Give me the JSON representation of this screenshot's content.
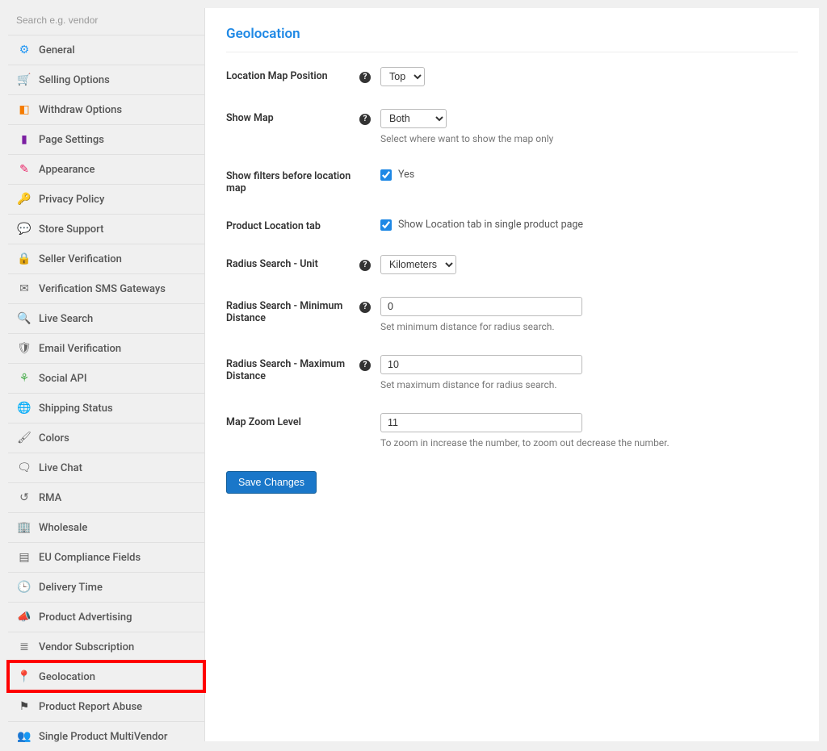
{
  "search": {
    "placeholder": "Search e.g. vendor"
  },
  "sidebar": {
    "items": [
      {
        "label": "General"
      },
      {
        "label": "Selling Options"
      },
      {
        "label": "Withdraw Options"
      },
      {
        "label": "Page Settings"
      },
      {
        "label": "Appearance"
      },
      {
        "label": "Privacy Policy"
      },
      {
        "label": "Store Support"
      },
      {
        "label": "Seller Verification"
      },
      {
        "label": "Verification SMS Gateways"
      },
      {
        "label": "Live Search"
      },
      {
        "label": "Email Verification"
      },
      {
        "label": "Social API"
      },
      {
        "label": "Shipping Status"
      },
      {
        "label": "Colors"
      },
      {
        "label": "Live Chat"
      },
      {
        "label": "RMA"
      },
      {
        "label": "Wholesale"
      },
      {
        "label": "EU Compliance Fields"
      },
      {
        "label": "Delivery Time"
      },
      {
        "label": "Product Advertising"
      },
      {
        "label": "Vendor Subscription"
      },
      {
        "label": "Geolocation"
      },
      {
        "label": "Product Report Abuse"
      },
      {
        "label": "Single Product MultiVendor"
      }
    ]
  },
  "page": {
    "title": "Geolocation"
  },
  "form": {
    "location_map_position": {
      "label": "Location Map Position",
      "value": "Top"
    },
    "show_map": {
      "label": "Show Map",
      "value": "Both",
      "desc": "Select where want to show the map only"
    },
    "show_filters": {
      "label": "Show filters before location map",
      "checked": true,
      "text": "Yes"
    },
    "product_location_tab": {
      "label": "Product Location tab",
      "checked": true,
      "text": "Show Location tab in single product page"
    },
    "radius_unit": {
      "label": "Radius Search - Unit",
      "value": "Kilometers"
    },
    "radius_min": {
      "label": "Radius Search - Minimum Distance",
      "value": "0",
      "desc": "Set minimum distance for radius search."
    },
    "radius_max": {
      "label": "Radius Search - Maximum Distance",
      "value": "10",
      "desc": "Set maximum distance for radius search."
    },
    "zoom": {
      "label": "Map Zoom Level",
      "value": "11",
      "desc": "To zoom in increase the number, to zoom out decrease the number."
    },
    "save_button": "Save Changes"
  }
}
